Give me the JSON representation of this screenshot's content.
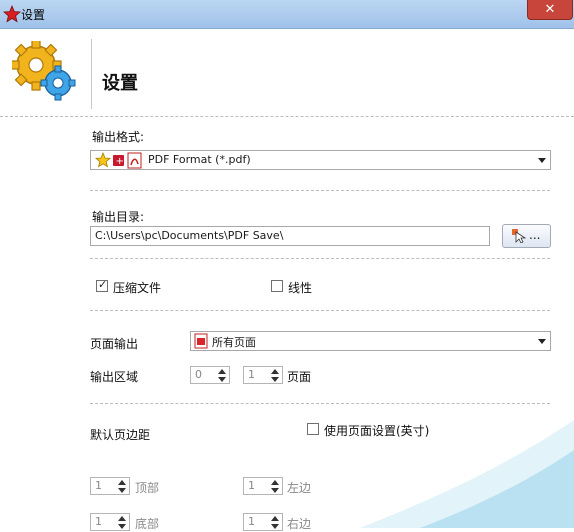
{
  "window": {
    "title": "设置",
    "close_glyph": "✕"
  },
  "header": {
    "title": "设置"
  },
  "output_format": {
    "label": "输出格式:",
    "selected": "PDF Format (*.pdf)"
  },
  "output_dir": {
    "label": "输出目录:",
    "path": "C:\\Users\\pc\\Documents\\PDF Save\\",
    "browse_label": "..."
  },
  "options": {
    "compress": {
      "label": "压缩文件",
      "checked": true
    },
    "linearize": {
      "label": "线性",
      "checked": false
    }
  },
  "page_output": {
    "label": "页面输出",
    "selected": "所有页面"
  },
  "output_range": {
    "label": "输出区域",
    "from": "0",
    "to": "1",
    "unit": "页面"
  },
  "margins": {
    "label": "默认页边距",
    "use_page_settings": {
      "label": "使用页面设置(英寸)",
      "checked": false
    },
    "top": {
      "value": "1",
      "label": "顶部"
    },
    "left": {
      "value": "1",
      "label": "左边"
    },
    "bottom": {
      "value": "1",
      "label": "底部"
    },
    "right": {
      "value": "1",
      "label": "右边"
    }
  },
  "colors": {
    "titlebar": "#9fc2ea",
    "close": "#c7453a",
    "swoosh": "#8fd0e8"
  },
  "icons": [
    "star-app-icon",
    "gears-icon",
    "star-icon",
    "plus-icon",
    "pdf-icon",
    "cursor-browse-icon",
    "pdf-page-icon"
  ]
}
